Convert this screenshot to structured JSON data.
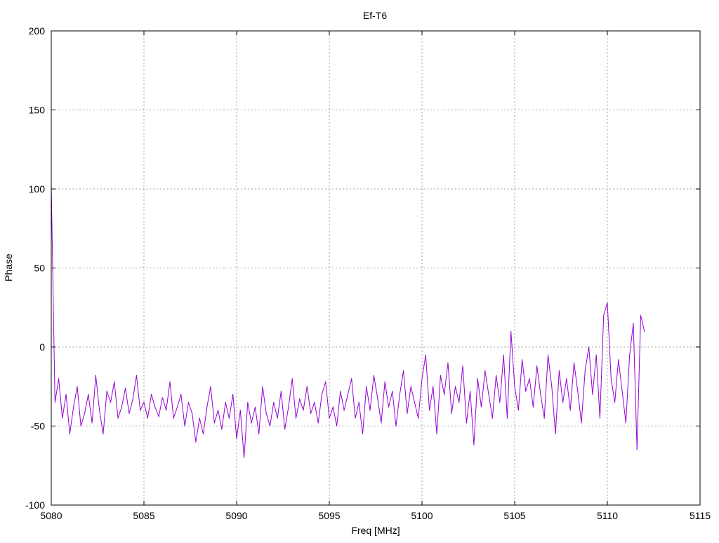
{
  "chart_data": {
    "type": "line",
    "title": "Ef-T6",
    "xlabel": "Freq [MHz]",
    "ylabel": "Phase",
    "xlim": [
      5080,
      5115
    ],
    "ylim": [
      -100,
      200
    ],
    "xticks": [
      5080,
      5085,
      5090,
      5095,
      5100,
      5105,
      5110,
      5115
    ],
    "yticks": [
      -100,
      -50,
      0,
      50,
      100,
      150,
      200
    ],
    "grid": true,
    "legend": "none",
    "series": [
      {
        "name": "Phase",
        "color": "#9400d3",
        "x_start": 5080,
        "x_step": 0.2,
        "values": [
          102,
          -35,
          -20,
          -45,
          -30,
          -55,
          -38,
          -25,
          -50,
          -42,
          -30,
          -48,
          -18,
          -40,
          -55,
          -28,
          -35,
          -22,
          -45,
          -38,
          -26,
          -42,
          -33,
          -18,
          -40,
          -35,
          -45,
          -30,
          -38,
          -44,
          -32,
          -40,
          -22,
          -45,
          -38,
          -30,
          -50,
          -35,
          -42,
          -60,
          -45,
          -55,
          -38,
          -25,
          -48,
          -40,
          -52,
          -35,
          -45,
          -30,
          -58,
          -40,
          -70,
          -35,
          -48,
          -38,
          -55,
          -25,
          -42,
          -50,
          -35,
          -45,
          -28,
          -52,
          -38,
          -20,
          -45,
          -33,
          -40,
          -25,
          -42,
          -35,
          -48,
          -30,
          -22,
          -45,
          -38,
          -50,
          -28,
          -40,
          -30,
          -20,
          -45,
          -35,
          -55,
          -25,
          -40,
          -18,
          -32,
          -48,
          -22,
          -38,
          -28,
          -50,
          -30,
          -15,
          -42,
          -25,
          -35,
          -45,
          -20,
          -5,
          -40,
          -25,
          -55,
          -18,
          -30,
          -10,
          -42,
          -25,
          -35,
          -12,
          -48,
          -28,
          -62,
          -20,
          -38,
          -15,
          -30,
          -45,
          -18,
          -35,
          -5,
          -45,
          10,
          -25,
          -40,
          -8,
          -28,
          -20,
          -38,
          -12,
          -30,
          -45,
          -5,
          -25,
          -55,
          -15,
          -35,
          -20,
          -40,
          -10,
          -28,
          -48,
          -15,
          0,
          -30,
          -5,
          -45,
          20,
          28,
          -20,
          -35,
          -8,
          -28,
          -48,
          -5,
          15,
          -65,
          20,
          10
        ]
      }
    ]
  }
}
